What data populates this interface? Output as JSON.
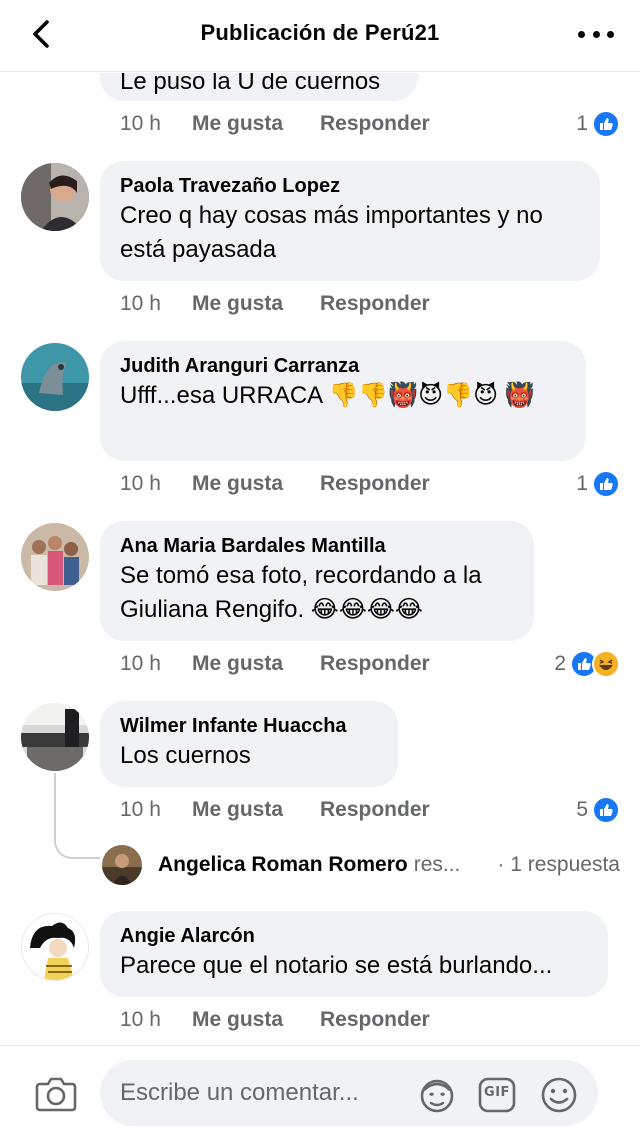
{
  "header": {
    "title": "Publicación de Perú21",
    "back_icon": "chevron-left-icon",
    "more_icon": "more-horizontal-icon"
  },
  "comments": [
    {
      "author": "",
      "text": "Le puso la U de cuernos",
      "time": "10 h",
      "like_label": "Me gusta",
      "reply_label": "Responder",
      "reaction_count": "1",
      "reactions": [
        "like"
      ]
    },
    {
      "author": "Paola Travezaño Lopez",
      "text": "Creo q hay cosas más importantes y no está payasada",
      "time": "10 h",
      "like_label": "Me gusta",
      "reply_label": "Responder",
      "reaction_count": "",
      "reactions": []
    },
    {
      "author": "Judith Aranguri Carranza",
      "text": "Ufff...esa URRACA 👎👎👹😈👎😈 👹",
      "time": "10 h",
      "like_label": "Me gusta",
      "reply_label": "Responder",
      "reaction_count": "1",
      "reactions": [
        "like"
      ]
    },
    {
      "author": "Ana Maria Bardales Mantilla",
      "text": "Se tomó esa foto, recordando a la Giuliana Rengifo. 😂😂😂😂",
      "time": "10 h",
      "like_label": "Me gusta",
      "reply_label": "Responder",
      "reaction_count": "2",
      "reactions": [
        "like",
        "haha"
      ]
    },
    {
      "author": "Wilmer Infante Huaccha",
      "text": "Los cuernos",
      "time": "10 h",
      "like_label": "Me gusta",
      "reply_label": "Responder",
      "reaction_count": "5",
      "reactions": [
        "like"
      ],
      "reply_preview": {
        "name": "Angelica Roman Romero",
        "verb": "res...",
        "count": "· 1 respuesta"
      }
    },
    {
      "author": "Angie Alarcón",
      "text": "Parece que el notario se está burlando...",
      "time": "10 h",
      "like_label": "Me gusta",
      "reply_label": "Responder",
      "reaction_count": "",
      "reactions": []
    }
  ],
  "composer": {
    "placeholder": "Escribe un comentar...",
    "camera_icon": "camera-icon",
    "avatar_icon": "avatar-sticker-icon",
    "gif_label": "GIF",
    "emoji_icon": "smiley-icon"
  },
  "colors": {
    "bubble": "#f0f2f5",
    "muted_text": "#65676b",
    "like_blue": "#1877f2",
    "haha_yellow": "#f7b125"
  }
}
